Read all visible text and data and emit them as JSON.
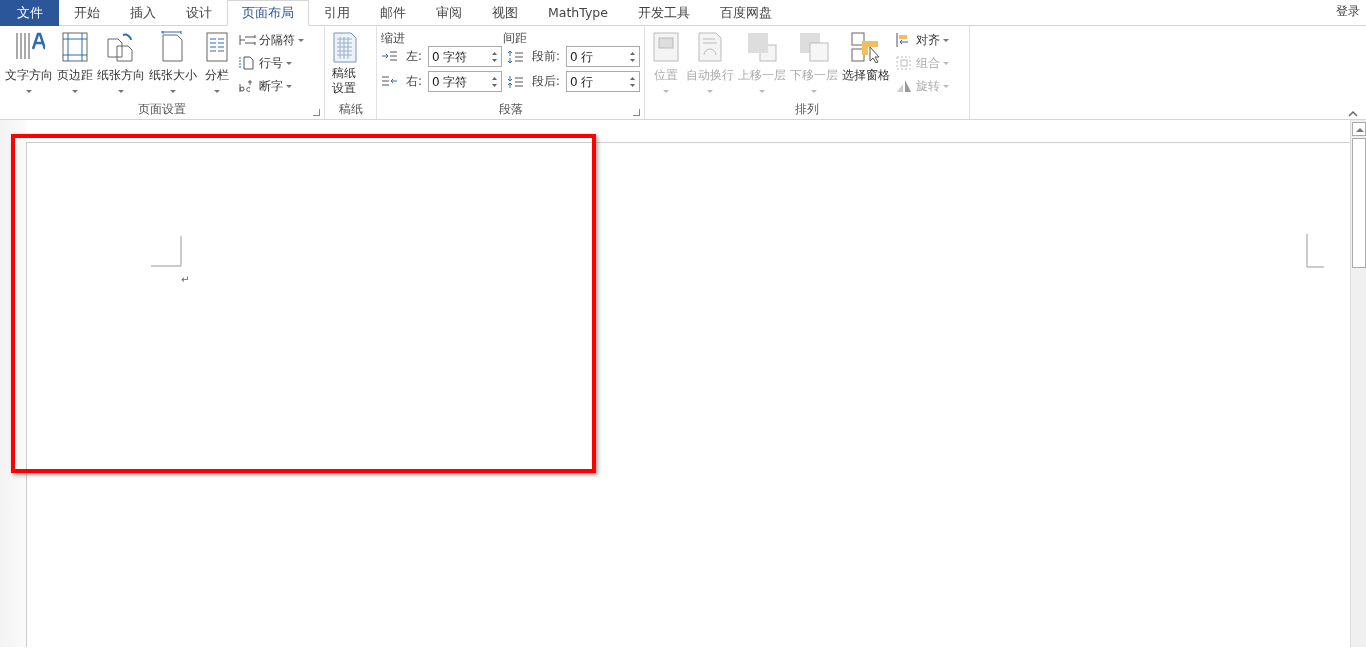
{
  "tabs": [
    {
      "label": "文件",
      "kind": "file",
      "selected": false
    },
    {
      "label": "开始",
      "kind": "tab",
      "selected": false
    },
    {
      "label": "插入",
      "kind": "tab",
      "selected": false
    },
    {
      "label": "设计",
      "kind": "tab",
      "selected": false
    },
    {
      "label": "页面布局",
      "kind": "tab",
      "selected": true
    },
    {
      "label": "引用",
      "kind": "tab",
      "selected": false
    },
    {
      "label": "邮件",
      "kind": "tab",
      "selected": false
    },
    {
      "label": "审阅",
      "kind": "tab",
      "selected": false
    },
    {
      "label": "视图",
      "kind": "tab",
      "selected": false
    },
    {
      "label": "MathType",
      "kind": "tab",
      "selected": false
    },
    {
      "label": "开发工具",
      "kind": "tab",
      "selected": false
    },
    {
      "label": "百度网盘",
      "kind": "tab",
      "selected": false
    }
  ],
  "sign_in": "登录",
  "page_setup": {
    "label": "页面设置",
    "large_buttons": [
      {
        "label": "文字方向"
      },
      {
        "label": "页边距"
      },
      {
        "label": "纸张方向"
      },
      {
        "label": "纸张大小"
      },
      {
        "label": "分栏"
      }
    ],
    "small_buttons": [
      {
        "label": "分隔符"
      },
      {
        "label": "行号"
      },
      {
        "label": "断字"
      }
    ]
  },
  "manuscript": {
    "label": "稿纸",
    "button": "稿纸设置"
  },
  "paragraph": {
    "label": "段落",
    "indent_label": "缩进",
    "spacing_label": "间距",
    "fields": [
      {
        "label": "左:",
        "value": "0 字符"
      },
      {
        "label": "段前:",
        "value": "0 行"
      },
      {
        "label": "右:",
        "value": "0 字符"
      },
      {
        "label": "段后:",
        "value": "0 行"
      }
    ]
  },
  "arrange": {
    "label": "排列",
    "large_buttons": [
      {
        "label": "位置",
        "disabled": true,
        "dropdown": true
      },
      {
        "label": "自动换行",
        "disabled": true,
        "dropdown": true
      },
      {
        "label": "上移一层",
        "disabled": true,
        "dropdown": true
      },
      {
        "label": "下移一层",
        "disabled": true,
        "dropdown": true
      },
      {
        "label": "选择窗格",
        "disabled": false,
        "dropdown": false
      }
    ],
    "small_buttons": [
      {
        "label": "对齐",
        "disabled": false
      },
      {
        "label": "组合",
        "disabled": true
      },
      {
        "label": "旋转",
        "disabled": true
      }
    ]
  },
  "document": {
    "paragraph_mark": "↵"
  }
}
